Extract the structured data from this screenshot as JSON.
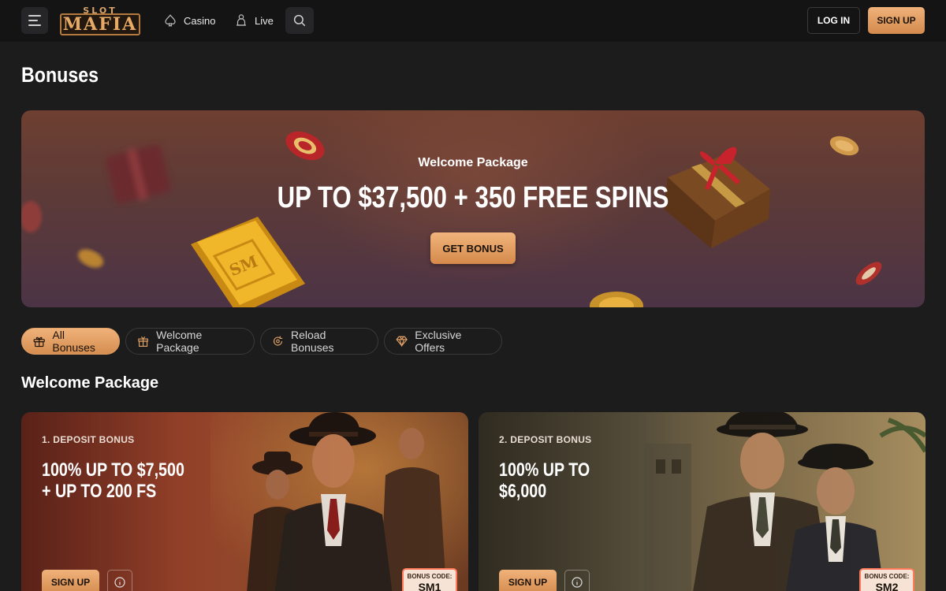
{
  "header": {
    "logo_top": "SLOT",
    "logo_main": "MAFIA",
    "nav": [
      {
        "label": "Casino",
        "icon": "spade-icon"
      },
      {
        "label": "Live",
        "icon": "dealer-icon"
      }
    ],
    "login_label": "LOG IN",
    "signup_label": "SIGN UP"
  },
  "page": {
    "title": "Bonuses"
  },
  "hero": {
    "subtitle": "Welcome Package",
    "title": "UP TO $37,500 + 350 FREE SPINS",
    "button_label": "GET BONUS",
    "gold_bar_text": "SM"
  },
  "filters": [
    {
      "label": "All Bonuses",
      "icon": "gift-icon",
      "active": true
    },
    {
      "label": "Welcome Package",
      "icon": "present-icon",
      "active": false
    },
    {
      "label": "Reload Bonuses",
      "icon": "reload-icon",
      "active": false
    },
    {
      "label": "Exclusive Offers",
      "icon": "diamond-icon",
      "active": false
    }
  ],
  "section": {
    "title": "Welcome Package"
  },
  "cards": [
    {
      "label": "1. DEPOSIT BONUS",
      "title_line1": "100% UP TO $7,500",
      "title_line2": "+ UP TO 200 FS",
      "signup_label": "SIGN UP",
      "code_label": "BONUS CODE:",
      "code_value": "SM1"
    },
    {
      "label": "2. DEPOSIT BONUS",
      "title_line1": "100% UP TO",
      "title_line2": "$6,000",
      "signup_label": "SIGN UP",
      "code_label": "BONUS CODE:",
      "code_value": "SM2"
    }
  ],
  "colors": {
    "accent": "#e2a165",
    "background": "#1c1c1d",
    "header": "#141415"
  }
}
